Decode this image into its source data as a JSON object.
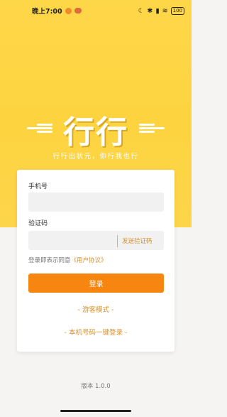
{
  "status_bar": {
    "time": "晚上7:00",
    "battery": "100"
  },
  "logo": {
    "title": "行行",
    "slogan": "行行出状元，你行我也行"
  },
  "login_form": {
    "phone_label": "手机号",
    "phone_value": "",
    "code_label": "验证码",
    "code_value": "",
    "send_code": "发送验证码",
    "agreement_prefix": "登录即表示同意",
    "agreement_link": "《用户协议》",
    "login_button": "登录",
    "guest_mode": "- 游客模式 -",
    "one_click_login": "- 本机号码一键登录 -"
  },
  "footer": {
    "version": "版本 1.0.0"
  },
  "colors": {
    "header_yellow": "#fdd33f",
    "accent_orange": "#f6860f",
    "link_orange": "#d9912a"
  }
}
